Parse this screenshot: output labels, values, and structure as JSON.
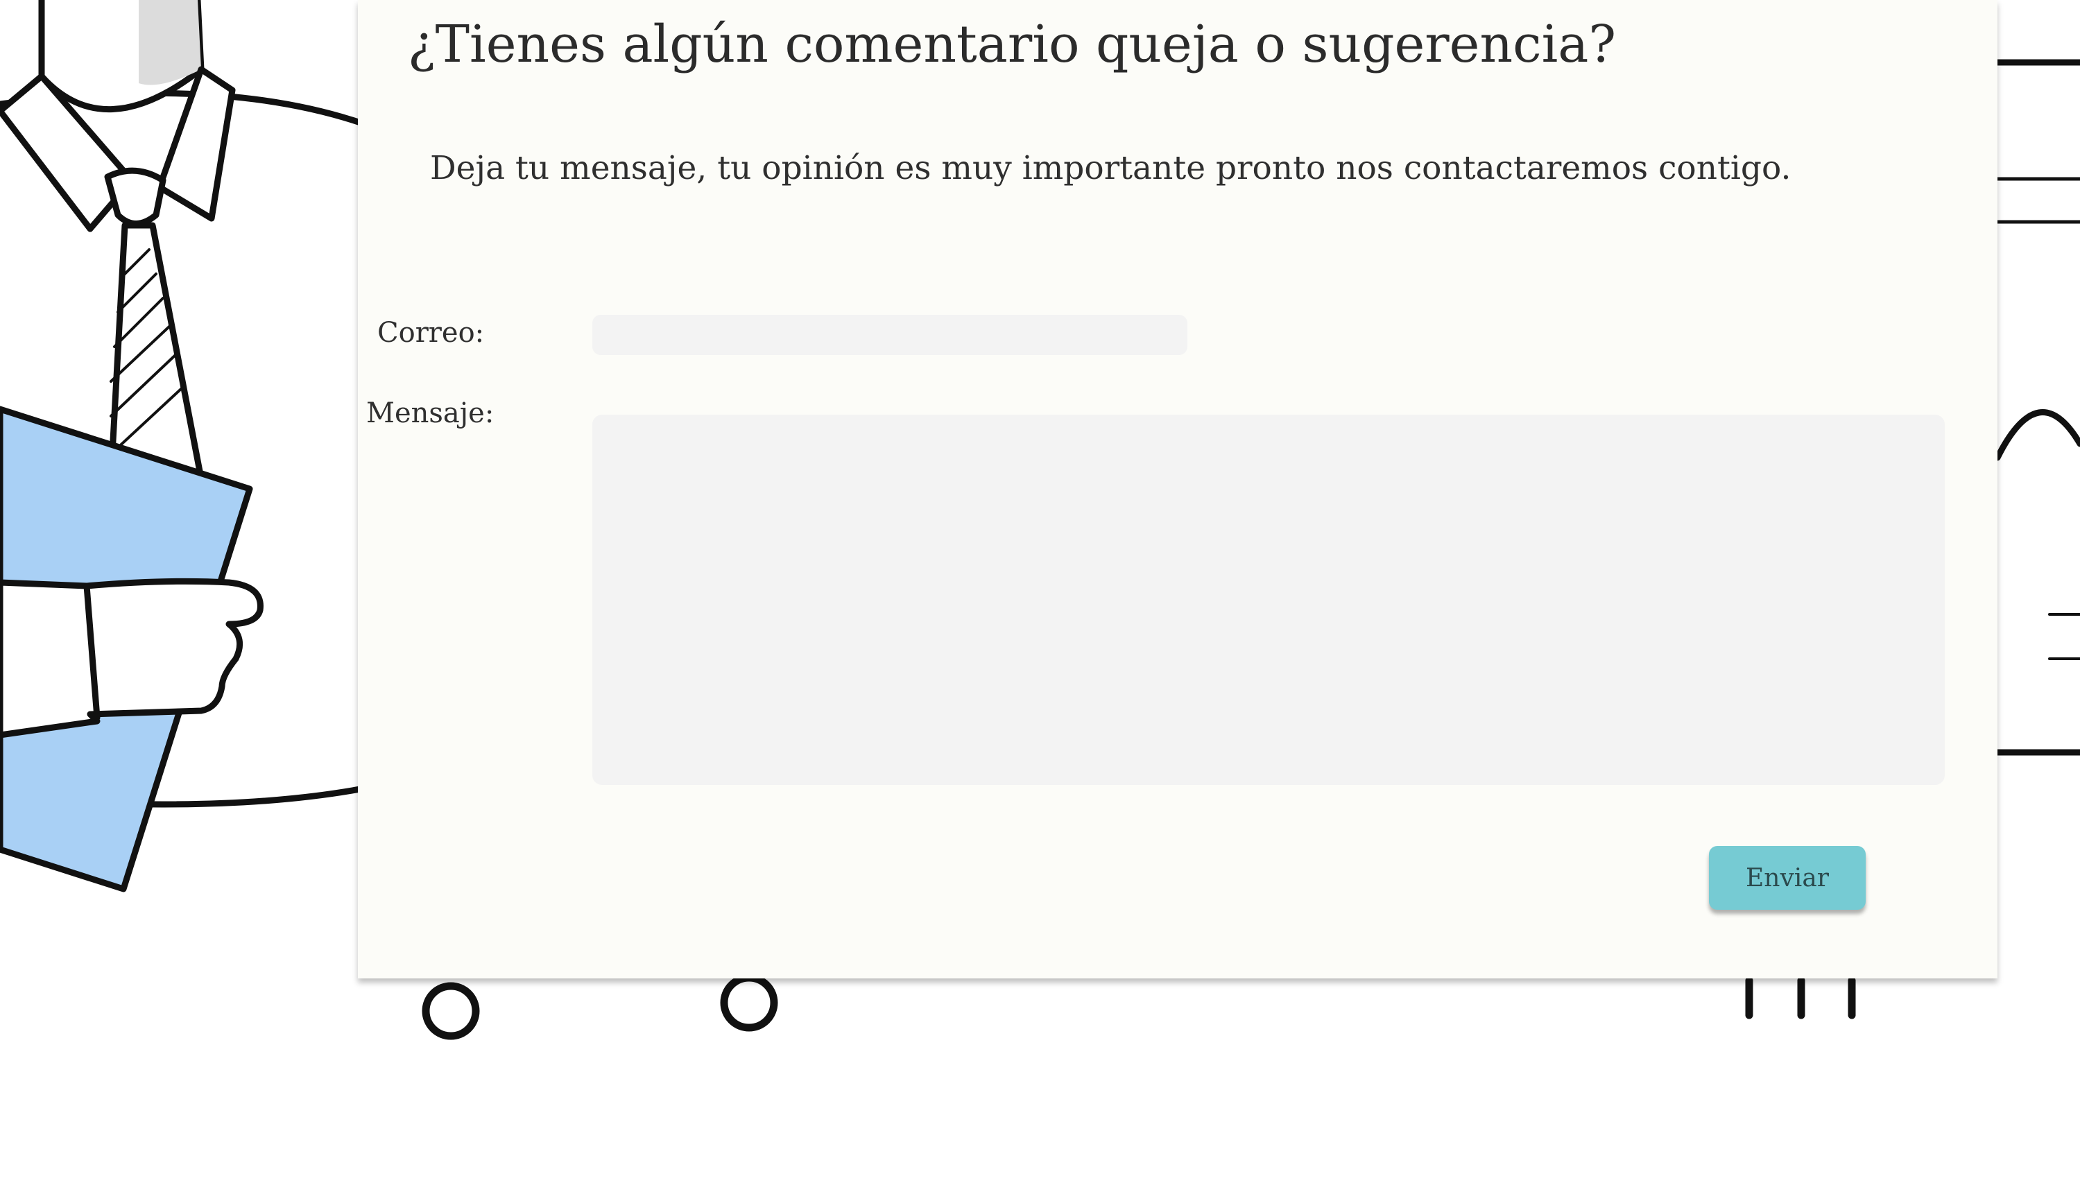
{
  "form": {
    "title": "¿Tienes algún comentario queja o sugerencia?",
    "subtitle": "Deja tu mensaje, tu opinión es muy importante pronto nos contactaremos contigo.",
    "email_label": "Correo:",
    "email_value": "",
    "message_label": "Mensaje:",
    "message_value": "",
    "submit_label": "Enviar"
  },
  "colors": {
    "panel_background": "#fcfcf8",
    "input_background": "#f3f3f3",
    "button_accent": "#76cbd3",
    "illustration_blue": "#a9d0f5"
  }
}
